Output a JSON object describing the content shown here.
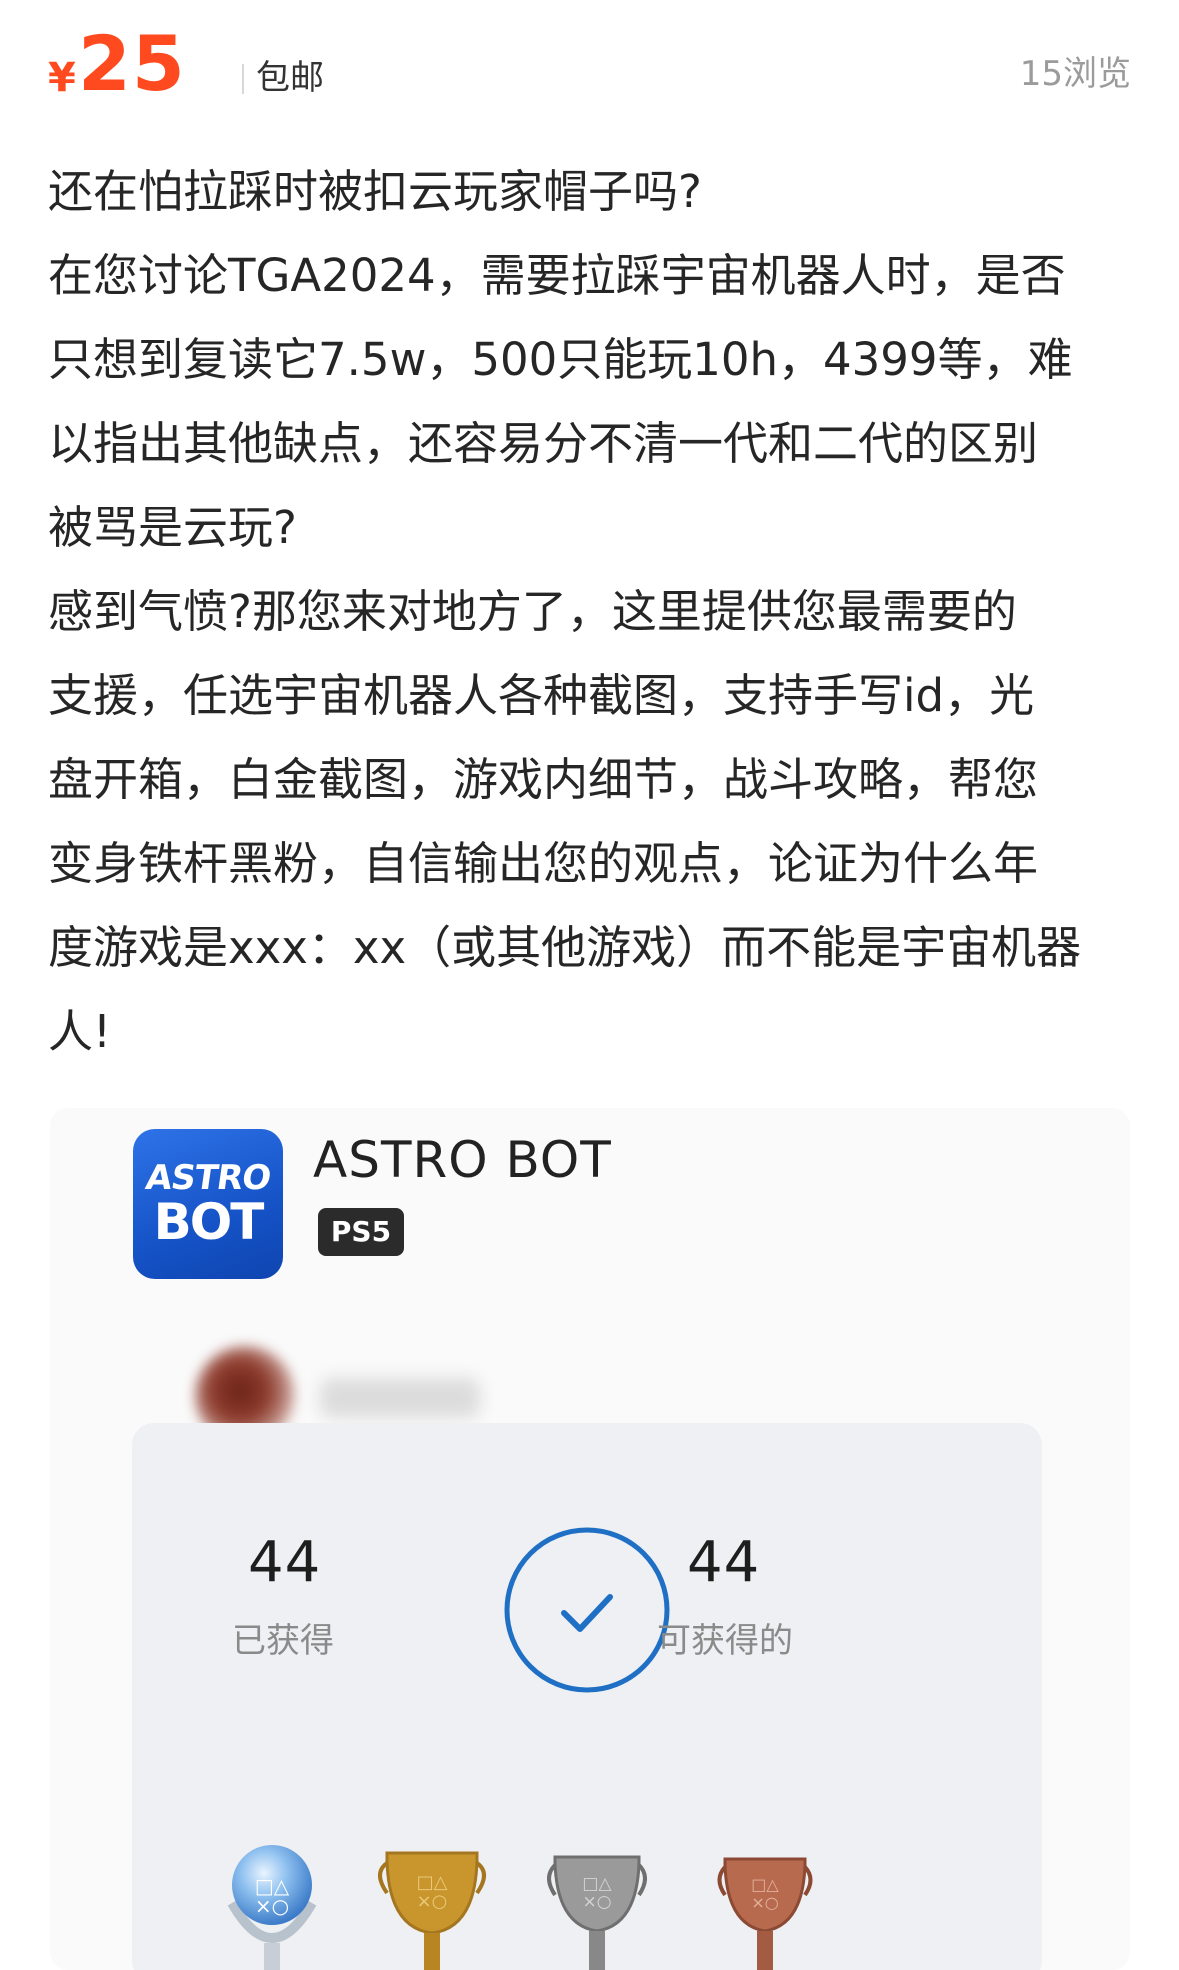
{
  "listing": {
    "currency": "¥",
    "price": "25",
    "shipping": "包邮",
    "views": "15浏览"
  },
  "description": {
    "lines": [
      "还在怕拉踩时被扣云玩家帽子吗?",
      "在您讨论TGA2024，需要拉踩宇宙机器人时，是否",
      "只想到复读它7.5w，500只能玩10h，4399等，难",
      "以指出其他缺点，还容易分不清一代和二代的区别",
      "被骂是云玩?",
      "感到气愤?那您来对地方了，这里提供您最需要的",
      "支援，任选宇宙机器人各种截图，支持手写id，光",
      "盘开箱，白金截图，游戏内细节，战斗攻略，帮您",
      "变身铁杆黑粉，自信输出您的观点，论证为什么年",
      "度游戏是xxx：xx（或其他游戏）而不能是宇宙机器",
      "人!"
    ]
  },
  "screenshot": {
    "app_icon": {
      "line1": "ASTRO",
      "line2": "BOT"
    },
    "game_title": "ASTRO BOT",
    "platform": "PS5",
    "earned_count": "44",
    "earned_label": "已获得",
    "available_count": "44",
    "available_label": "可获得的",
    "completion_fraction": 1.0,
    "trophies": [
      "platinum-trophy",
      "gold-trophy",
      "silver-trophy",
      "bronze-trophy"
    ],
    "colors": {
      "ring": "#1f6fc5",
      "platinum": "#7fb3e6",
      "gold": "#c9962e",
      "silver": "#9a9a9a",
      "bronze": "#b86a4e"
    }
  },
  "colors": {
    "price": "#ff4a1f",
    "muted": "#9b9b9b"
  }
}
